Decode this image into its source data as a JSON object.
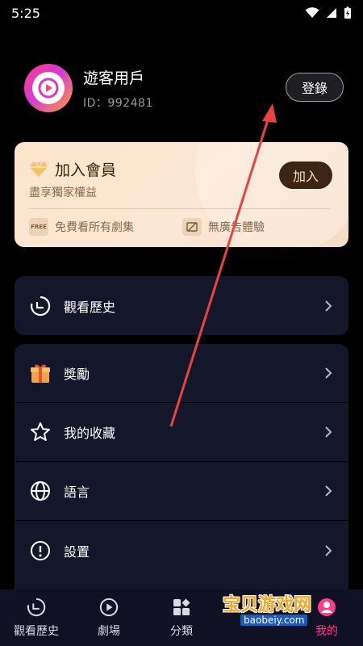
{
  "status": {
    "time": "5:25"
  },
  "profile": {
    "name": "遊客用戶",
    "id": "ID：992481",
    "login_label": "登錄"
  },
  "vip": {
    "title": "加入會員",
    "subtitle": "盡享獨家權益",
    "join_label": "加入",
    "perks": [
      {
        "icon_text": "FREE",
        "label": "免費看所有劇集"
      },
      {
        "label": "無廣告體驗"
      }
    ]
  },
  "menu_top": [
    {
      "icon": "history-icon",
      "label": "觀看歷史"
    }
  ],
  "menu_main": [
    {
      "icon": "gift-icon",
      "label": "獎勵"
    },
    {
      "icon": "star-icon",
      "label": "我的收藏"
    },
    {
      "icon": "globe-icon",
      "label": "語言"
    },
    {
      "icon": "alert-icon",
      "label": "設置"
    }
  ],
  "tabs": [
    {
      "label": "觀看歷史",
      "icon": "history-icon"
    },
    {
      "label": "劇場",
      "icon": "play-icon"
    },
    {
      "label": "分類",
      "icon": "grid-icon"
    },
    {
      "label": "",
      "icon": "reward-icon"
    },
    {
      "label": "我的",
      "icon": "profile-icon",
      "active": true
    }
  ],
  "watermark": {
    "text": "宝贝游戏网",
    "url": "baobeiy.com"
  },
  "colors": {
    "accent": "#ff3d8a",
    "vip_bg": "#fde4cc",
    "card_bg": "#14162a"
  }
}
